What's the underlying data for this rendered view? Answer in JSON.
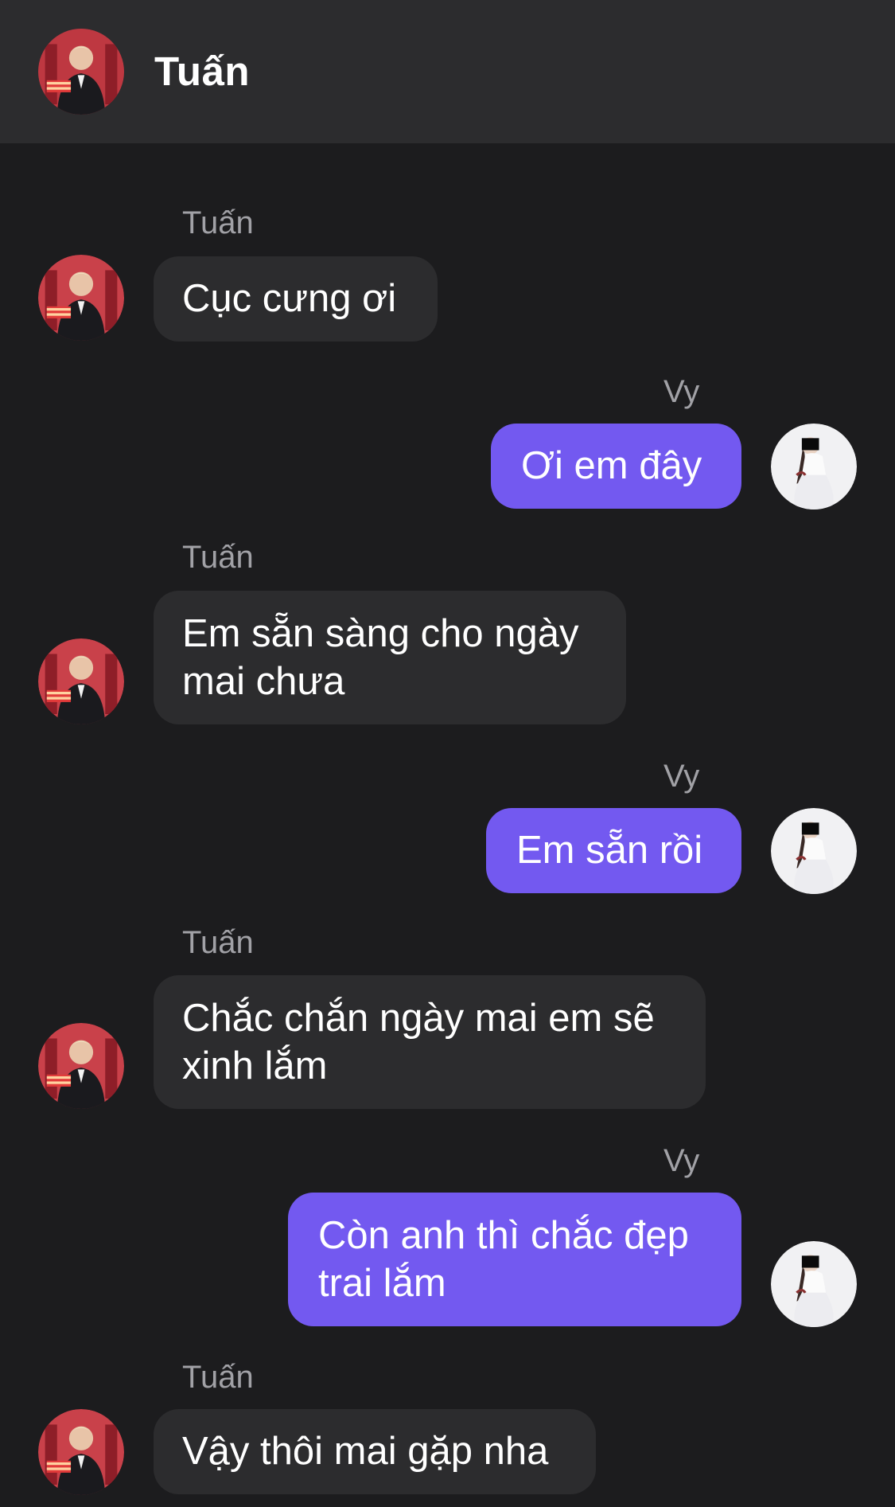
{
  "header": {
    "title": "Tuấn",
    "avatar_icon": "avatar-tuan"
  },
  "colors": {
    "background": "#1c1c1e",
    "header": "#2c2c2e",
    "incoming_bubble": "#2c2c2e",
    "outgoing_bubble": "#7359f0",
    "sender_label": "#a1a1a6"
  },
  "messages": [
    {
      "sender": "Tuấn",
      "direction": "incoming",
      "lines": [
        "Cục cưng ơi"
      ]
    },
    {
      "sender": "Vy",
      "direction": "outgoing",
      "lines": [
        "Ơi em đây"
      ]
    },
    {
      "sender": "Tuấn",
      "direction": "incoming",
      "lines": [
        "Em sẵn sàng cho ngày",
        "mai chưa"
      ]
    },
    {
      "sender": "Vy",
      "direction": "outgoing",
      "lines": [
        "Em sẵn rồi"
      ]
    },
    {
      "sender": "Tuấn",
      "direction": "incoming",
      "lines": [
        "Chắc chắn ngày mai em sẽ",
        "xinh lắm"
      ]
    },
    {
      "sender": "Vy",
      "direction": "outgoing",
      "lines": [
        "Còn anh thì chắc đẹp",
        "trai lắm"
      ]
    },
    {
      "sender": "Tuấn",
      "direction": "incoming",
      "lines": [
        "Vậy thôi mai gặp nha"
      ]
    }
  ]
}
